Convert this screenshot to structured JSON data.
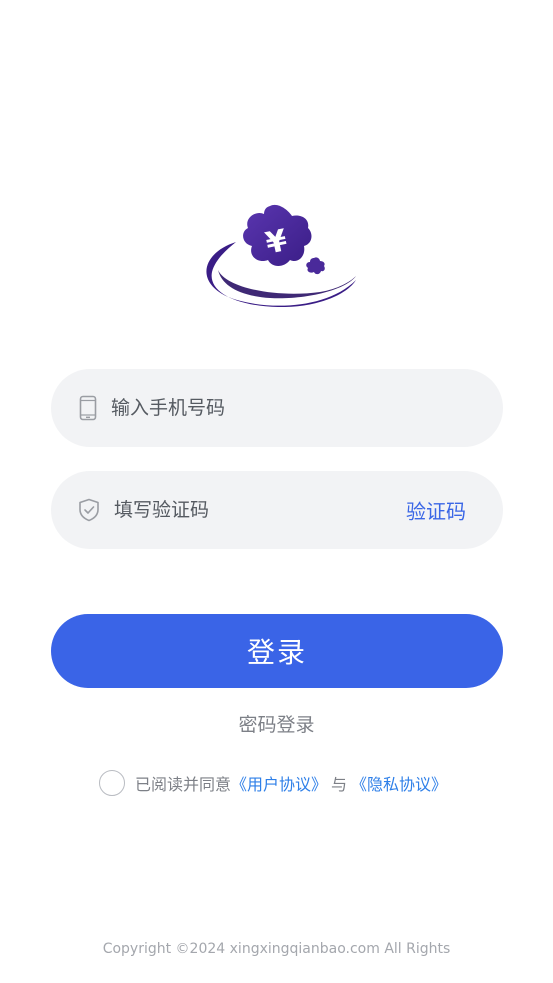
{
  "logo": {
    "icon": "yen-flower-logo-icon",
    "colors": {
      "primary": "#4a2a9a",
      "dark": "#2c1470"
    }
  },
  "form": {
    "phone": {
      "placeholder": "输入手机号码",
      "icon": "mobile-phone-icon"
    },
    "code": {
      "placeholder": "填写验证码",
      "icon": "shield-check-icon",
      "get_code_label": "验证码"
    },
    "login_label": "登录",
    "password_login_label": "密码登录"
  },
  "agreement": {
    "prefix": "已阅读并同意",
    "user_agreement": "《用户协议》",
    "separator": "与",
    "privacy_agreement": "《隐私协议》",
    "checked": false
  },
  "footer": {
    "copyright": "Copyright ©2024 xingxingqianbao.com All Rights"
  },
  "colors": {
    "accent": "#3a64e7",
    "link": "#2e7fe8",
    "field_bg": "#f2f3f5"
  }
}
